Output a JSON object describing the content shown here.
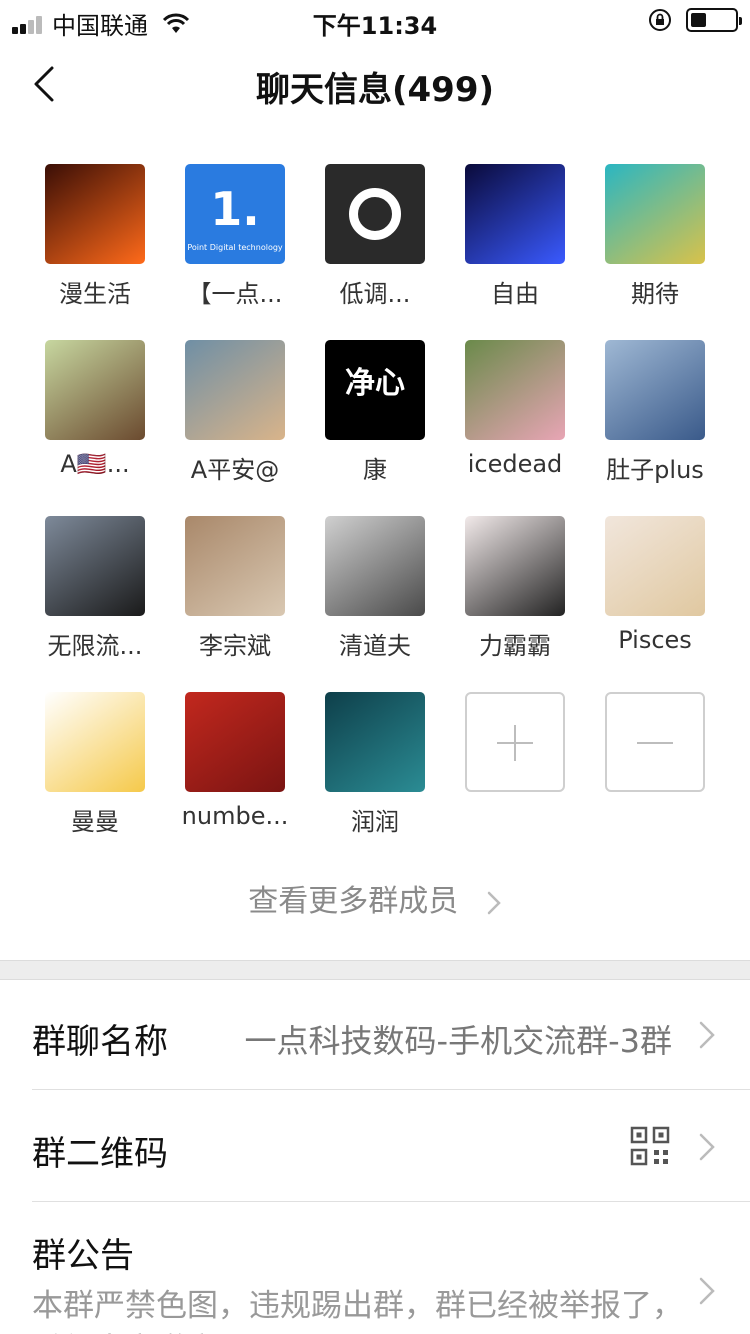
{
  "status_bar": {
    "carrier": "中国联通",
    "time": "下午11:34",
    "battery_level": 0.35
  },
  "nav": {
    "title": "聊天信息(499)"
  },
  "members": [
    {
      "name": "漫生活",
      "avatar_colors": [
        "#3a0e06",
        "#ff6a1a"
      ]
    },
    {
      "name": "【一点...",
      "avatar_colors": [
        "#2a7be0",
        "#2a7be0"
      ],
      "avatar_text": "1.",
      "avatar_sub": "Point Digital technology"
    },
    {
      "name": "低调...",
      "avatar_colors": [
        "#2a2a2a",
        "#2a2a2a"
      ]
    },
    {
      "name": "自由",
      "avatar_colors": [
        "#0a0a3a",
        "#3a5aff"
      ]
    },
    {
      "name": "期待",
      "avatar_colors": [
        "#2ab6c2",
        "#d9c24a"
      ]
    },
    {
      "name": "A🇺🇸...",
      "avatar_colors": [
        "#c7d7a0",
        "#6b4a2f"
      ]
    },
    {
      "name": "A平安@",
      "avatar_colors": [
        "#6f8fa5",
        "#d9b48a"
      ]
    },
    {
      "name": "康",
      "avatar_colors": [
        "#000000",
        "#000000"
      ],
      "avatar_text": "净心"
    },
    {
      "name": "icedead",
      "avatar_colors": [
        "#6a8a4a",
        "#e8a5b5"
      ]
    },
    {
      "name": "肚子plus",
      "avatar_colors": [
        "#9fb8d4",
        "#3a5a8a"
      ]
    },
    {
      "name": "无限流...",
      "avatar_colors": [
        "#7e8a9a",
        "#1a1a1a"
      ]
    },
    {
      "name": "李宗斌",
      "avatar_colors": [
        "#a9886a",
        "#d9c8b2"
      ]
    },
    {
      "name": "清道夫",
      "avatar_colors": [
        "#d0d0d0",
        "#4a4a4a"
      ]
    },
    {
      "name": "力霸霸",
      "avatar_colors": [
        "#f2eaea",
        "#222222"
      ]
    },
    {
      "name": "Pisces",
      "avatar_colors": [
        "#f1e6dc",
        "#e0c8a0"
      ]
    },
    {
      "name": "曼曼",
      "avatar_colors": [
        "#ffffff",
        "#f5c94a"
      ]
    },
    {
      "name": "numbe...",
      "avatar_colors": [
        "#c2281e",
        "#7a1412"
      ]
    },
    {
      "name": "润润",
      "avatar_colors": [
        "#0e3f4a",
        "#2b8c94"
      ]
    }
  ],
  "more_members_label": "查看更多群成员",
  "settings": {
    "group_name_label": "群聊名称",
    "group_name_value": "一点科技数码-手机交流群-3群",
    "qr_label": "群二维码",
    "notice_label": "群公告",
    "notice_line1": "本群严禁色图，违规踢出群，群已经被举报了，",
    "notice_line2": "希望大家遵守，否!"
  },
  "icons": {
    "back": "chevron-left-icon",
    "add": "plus-icon",
    "remove": "minus-icon",
    "row_arrow": "chevron-right-icon",
    "qr": "qr-code-icon"
  }
}
